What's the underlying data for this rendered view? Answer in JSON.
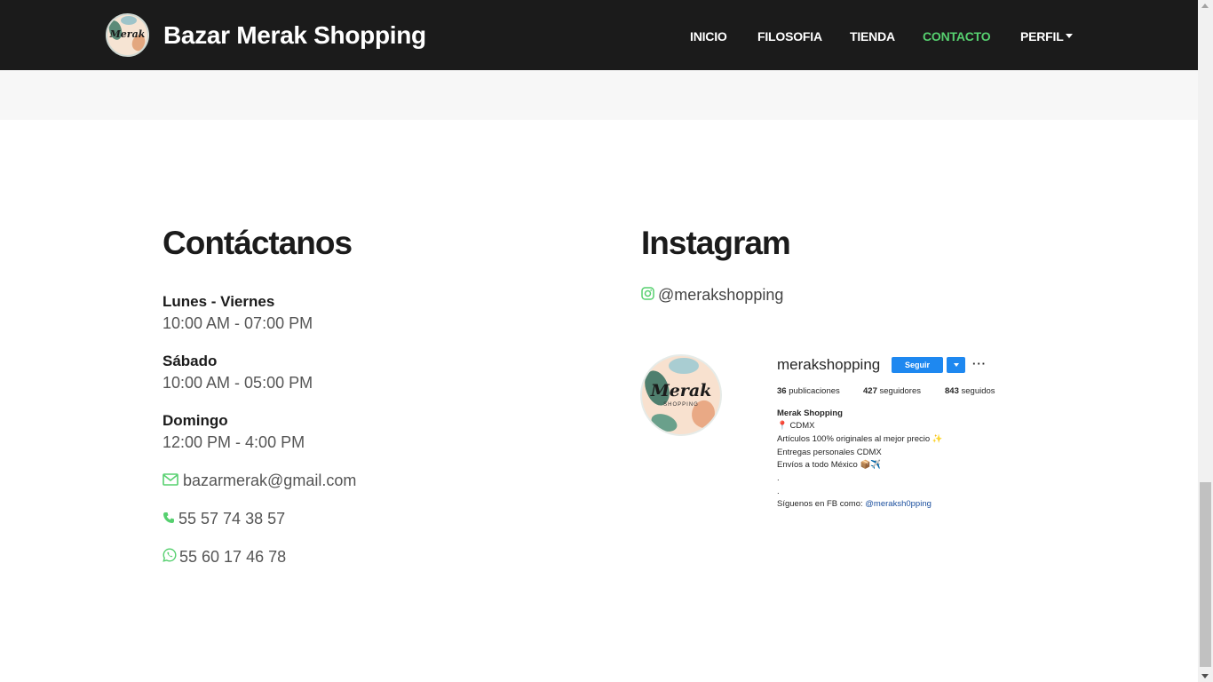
{
  "navbar": {
    "brand_logo_text": "Merak",
    "brand_title": "Bazar Merak Shopping",
    "links": [
      {
        "label": "INICIO",
        "active": false
      },
      {
        "label": "FILOSOFIA",
        "active": false
      },
      {
        "label": "TIENDA",
        "active": false
      },
      {
        "label": "CONTACTO",
        "active": true
      },
      {
        "label": "PERFIL",
        "active": false,
        "dropdown": true
      }
    ],
    "background_color": "#1b1b1b",
    "active_color": "#56d06f"
  },
  "contact": {
    "title": "Contáctanos",
    "schedule": [
      {
        "day": "Lunes - Viernes",
        "hours": "10:00 AM - 07:00 PM"
      },
      {
        "day": "Sábado",
        "hours": "10:00 AM - 05:00 PM"
      },
      {
        "day": "Domingo",
        "hours": "12:00 PM - 4:00 PM"
      }
    ],
    "email": {
      "icon": "envelope-icon",
      "value": "bazarmerak@gmail.com"
    },
    "phone": {
      "icon": "phone-icon",
      "value": "55 57 74 38 57"
    },
    "whatsapp": {
      "icon": "whatsapp-icon",
      "value": "55 60 17 46 78"
    },
    "icon_color": "#56d06f"
  },
  "instagram": {
    "title": "Instagram",
    "handle": "@merakshopping",
    "handle_icon": "instagram-icon",
    "profile": {
      "avatar_text": "Merak",
      "avatar_subtext": "SHOPPING",
      "username": "merakshopping",
      "follow_label": "Seguir",
      "more_label": "···",
      "stats": {
        "posts_count": "36",
        "posts_label": "publicaciones",
        "followers_count": "427",
        "followers_label": "seguidores",
        "following_count": "843",
        "following_label": "seguidos"
      },
      "bio": {
        "name": "Merak Shopping",
        "location": "📍 CDMX",
        "line1": "Artículos 100% originales al mejor precio ✨",
        "line2": "Entregas personales CDMX",
        "line3": "Envíos a todo México 📦✈️",
        "dot1": ".",
        "dot2": ".",
        "fb_prefix": "Síguenos en FB como: ",
        "fb_handle": "@meraksh0pping"
      },
      "follow_color": "#1e88f0"
    }
  }
}
